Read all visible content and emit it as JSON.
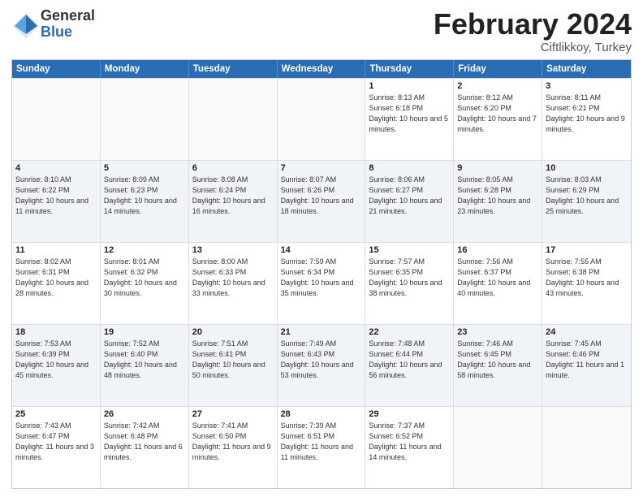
{
  "logo": {
    "general": "General",
    "blue": "Blue"
  },
  "title": {
    "month": "February 2024",
    "location": "Ciftlikkoy, Turkey"
  },
  "calendar": {
    "headers": [
      "Sunday",
      "Monday",
      "Tuesday",
      "Wednesday",
      "Thursday",
      "Friday",
      "Saturday"
    ],
    "rows": [
      [
        {
          "day": "",
          "sunrise": "",
          "sunset": "",
          "daylight": ""
        },
        {
          "day": "",
          "sunrise": "",
          "sunset": "",
          "daylight": ""
        },
        {
          "day": "",
          "sunrise": "",
          "sunset": "",
          "daylight": ""
        },
        {
          "day": "",
          "sunrise": "",
          "sunset": "",
          "daylight": ""
        },
        {
          "day": "1",
          "sunrise": "Sunrise: 8:13 AM",
          "sunset": "Sunset: 6:18 PM",
          "daylight": "Daylight: 10 hours and 5 minutes."
        },
        {
          "day": "2",
          "sunrise": "Sunrise: 8:12 AM",
          "sunset": "Sunset: 6:20 PM",
          "daylight": "Daylight: 10 hours and 7 minutes."
        },
        {
          "day": "3",
          "sunrise": "Sunrise: 8:11 AM",
          "sunset": "Sunset: 6:21 PM",
          "daylight": "Daylight: 10 hours and 9 minutes."
        }
      ],
      [
        {
          "day": "4",
          "sunrise": "Sunrise: 8:10 AM",
          "sunset": "Sunset: 6:22 PM",
          "daylight": "Daylight: 10 hours and 11 minutes."
        },
        {
          "day": "5",
          "sunrise": "Sunrise: 8:09 AM",
          "sunset": "Sunset: 6:23 PM",
          "daylight": "Daylight: 10 hours and 14 minutes."
        },
        {
          "day": "6",
          "sunrise": "Sunrise: 8:08 AM",
          "sunset": "Sunset: 6:24 PM",
          "daylight": "Daylight: 10 hours and 16 minutes."
        },
        {
          "day": "7",
          "sunrise": "Sunrise: 8:07 AM",
          "sunset": "Sunset: 6:26 PM",
          "daylight": "Daylight: 10 hours and 18 minutes."
        },
        {
          "day": "8",
          "sunrise": "Sunrise: 8:06 AM",
          "sunset": "Sunset: 6:27 PM",
          "daylight": "Daylight: 10 hours and 21 minutes."
        },
        {
          "day": "9",
          "sunrise": "Sunrise: 8:05 AM",
          "sunset": "Sunset: 6:28 PM",
          "daylight": "Daylight: 10 hours and 23 minutes."
        },
        {
          "day": "10",
          "sunrise": "Sunrise: 8:03 AM",
          "sunset": "Sunset: 6:29 PM",
          "daylight": "Daylight: 10 hours and 25 minutes."
        }
      ],
      [
        {
          "day": "11",
          "sunrise": "Sunrise: 8:02 AM",
          "sunset": "Sunset: 6:31 PM",
          "daylight": "Daylight: 10 hours and 28 minutes."
        },
        {
          "day": "12",
          "sunrise": "Sunrise: 8:01 AM",
          "sunset": "Sunset: 6:32 PM",
          "daylight": "Daylight: 10 hours and 30 minutes."
        },
        {
          "day": "13",
          "sunrise": "Sunrise: 8:00 AM",
          "sunset": "Sunset: 6:33 PM",
          "daylight": "Daylight: 10 hours and 33 minutes."
        },
        {
          "day": "14",
          "sunrise": "Sunrise: 7:59 AM",
          "sunset": "Sunset: 6:34 PM",
          "daylight": "Daylight: 10 hours and 35 minutes."
        },
        {
          "day": "15",
          "sunrise": "Sunrise: 7:57 AM",
          "sunset": "Sunset: 6:35 PM",
          "daylight": "Daylight: 10 hours and 38 minutes."
        },
        {
          "day": "16",
          "sunrise": "Sunrise: 7:56 AM",
          "sunset": "Sunset: 6:37 PM",
          "daylight": "Daylight: 10 hours and 40 minutes."
        },
        {
          "day": "17",
          "sunrise": "Sunrise: 7:55 AM",
          "sunset": "Sunset: 6:38 PM",
          "daylight": "Daylight: 10 hours and 43 minutes."
        }
      ],
      [
        {
          "day": "18",
          "sunrise": "Sunrise: 7:53 AM",
          "sunset": "Sunset: 6:39 PM",
          "daylight": "Daylight: 10 hours and 45 minutes."
        },
        {
          "day": "19",
          "sunrise": "Sunrise: 7:52 AM",
          "sunset": "Sunset: 6:40 PM",
          "daylight": "Daylight: 10 hours and 48 minutes."
        },
        {
          "day": "20",
          "sunrise": "Sunrise: 7:51 AM",
          "sunset": "Sunset: 6:41 PM",
          "daylight": "Daylight: 10 hours and 50 minutes."
        },
        {
          "day": "21",
          "sunrise": "Sunrise: 7:49 AM",
          "sunset": "Sunset: 6:43 PM",
          "daylight": "Daylight: 10 hours and 53 minutes."
        },
        {
          "day": "22",
          "sunrise": "Sunrise: 7:48 AM",
          "sunset": "Sunset: 6:44 PM",
          "daylight": "Daylight: 10 hours and 56 minutes."
        },
        {
          "day": "23",
          "sunrise": "Sunrise: 7:46 AM",
          "sunset": "Sunset: 6:45 PM",
          "daylight": "Daylight: 10 hours and 58 minutes."
        },
        {
          "day": "24",
          "sunrise": "Sunrise: 7:45 AM",
          "sunset": "Sunset: 6:46 PM",
          "daylight": "Daylight: 11 hours and 1 minute."
        }
      ],
      [
        {
          "day": "25",
          "sunrise": "Sunrise: 7:43 AM",
          "sunset": "Sunset: 6:47 PM",
          "daylight": "Daylight: 11 hours and 3 minutes."
        },
        {
          "day": "26",
          "sunrise": "Sunrise: 7:42 AM",
          "sunset": "Sunset: 6:48 PM",
          "daylight": "Daylight: 11 hours and 6 minutes."
        },
        {
          "day": "27",
          "sunrise": "Sunrise: 7:41 AM",
          "sunset": "Sunset: 6:50 PM",
          "daylight": "Daylight: 11 hours and 9 minutes."
        },
        {
          "day": "28",
          "sunrise": "Sunrise: 7:39 AM",
          "sunset": "Sunset: 6:51 PM",
          "daylight": "Daylight: 11 hours and 11 minutes."
        },
        {
          "day": "29",
          "sunrise": "Sunrise: 7:37 AM",
          "sunset": "Sunset: 6:52 PM",
          "daylight": "Daylight: 11 hours and 14 minutes."
        },
        {
          "day": "",
          "sunrise": "",
          "sunset": "",
          "daylight": ""
        },
        {
          "day": "",
          "sunrise": "",
          "sunset": "",
          "daylight": ""
        }
      ]
    ]
  }
}
